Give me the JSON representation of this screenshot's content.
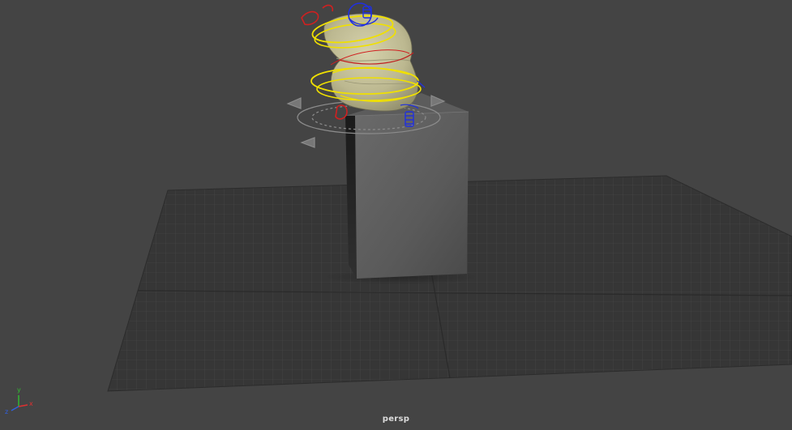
{
  "viewport": {
    "camera_name": "persp",
    "background_color": "#444444"
  },
  "axis_gizmo": {
    "x_label": "x",
    "y_label": "y",
    "z_label": "z",
    "x_color": "#e03030",
    "y_color": "#30c030",
    "z_color": "#3060e0"
  },
  "scene": {
    "ground_grid": "grid-plane",
    "pedestal": "cube",
    "character": "sack-character-rig",
    "rig_controls": {
      "yellow_rings": "#f0e000",
      "red_controls": "#d02020",
      "blue_controls": "#2030e0",
      "move_manipulator": "#9a9a9a"
    }
  }
}
